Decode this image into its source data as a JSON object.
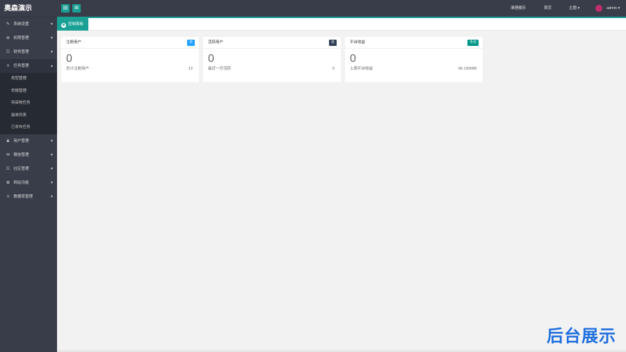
{
  "app": {
    "title": "奥森演示"
  },
  "sidebar": {
    "items": [
      {
        "label": "系统设置",
        "icon": "wrench-icon",
        "glyph": "✎",
        "arrow": "▼"
      },
      {
        "label": "权限管理",
        "icon": "globe-icon",
        "glyph": "⊕",
        "arrow": "▼"
      },
      {
        "label": "财务管理",
        "icon": "chart-icon",
        "glyph": "☷",
        "arrow": "▼"
      },
      {
        "label": "任务管理",
        "icon": "database-icon",
        "glyph": "≡",
        "arrow": "▲"
      },
      {
        "label": "用户管理",
        "icon": "user-icon",
        "glyph": "♟",
        "arrow": "▼"
      },
      {
        "label": "微信管理",
        "icon": "chat-icon",
        "glyph": "✉",
        "arrow": "▼"
      },
      {
        "label": "社区管理",
        "icon": "list-icon",
        "glyph": "☷",
        "arrow": "▼"
      },
      {
        "label": "网站功能",
        "icon": "gear-icon",
        "glyph": "✿",
        "arrow": "▼"
      },
      {
        "label": "数据库管理",
        "icon": "database-icon",
        "glyph": "≡",
        "arrow": "▼"
      }
    ],
    "submenu": [
      "类型管理",
      "举报管理",
      "待审核任务",
      "接单列表",
      "已发布任务"
    ]
  },
  "topbar": {
    "clear_cache": "清理缓存",
    "home": "首页",
    "theme": "主题 ▾",
    "user": "admin ▾",
    "menu_toggle_glyph": "▤",
    "grid_glyph": "⊞"
  },
  "tabs": [
    {
      "label": "控制面板"
    }
  ],
  "cards": [
    {
      "title": "注册用户",
      "badge": "日",
      "badge_color": "#1e9fff",
      "value": "0",
      "foot_label": "总计注册用户",
      "foot_value": "13"
    },
    {
      "title": "活跃用户",
      "badge": "日",
      "badge_color": "#2f4056",
      "value": "0",
      "foot_label": "最近一月活跃",
      "foot_value": "5"
    },
    {
      "title": "平台收益",
      "badge": "今日",
      "badge_color": "#009688",
      "value": "0",
      "foot_label": "上周平台收益",
      "foot_value": "96.193688"
    }
  ],
  "watermark": "后台展示",
  "colors": {
    "accent": "#1aa094",
    "sidebar": "#393d49",
    "watermark": "#1e6fe0"
  }
}
